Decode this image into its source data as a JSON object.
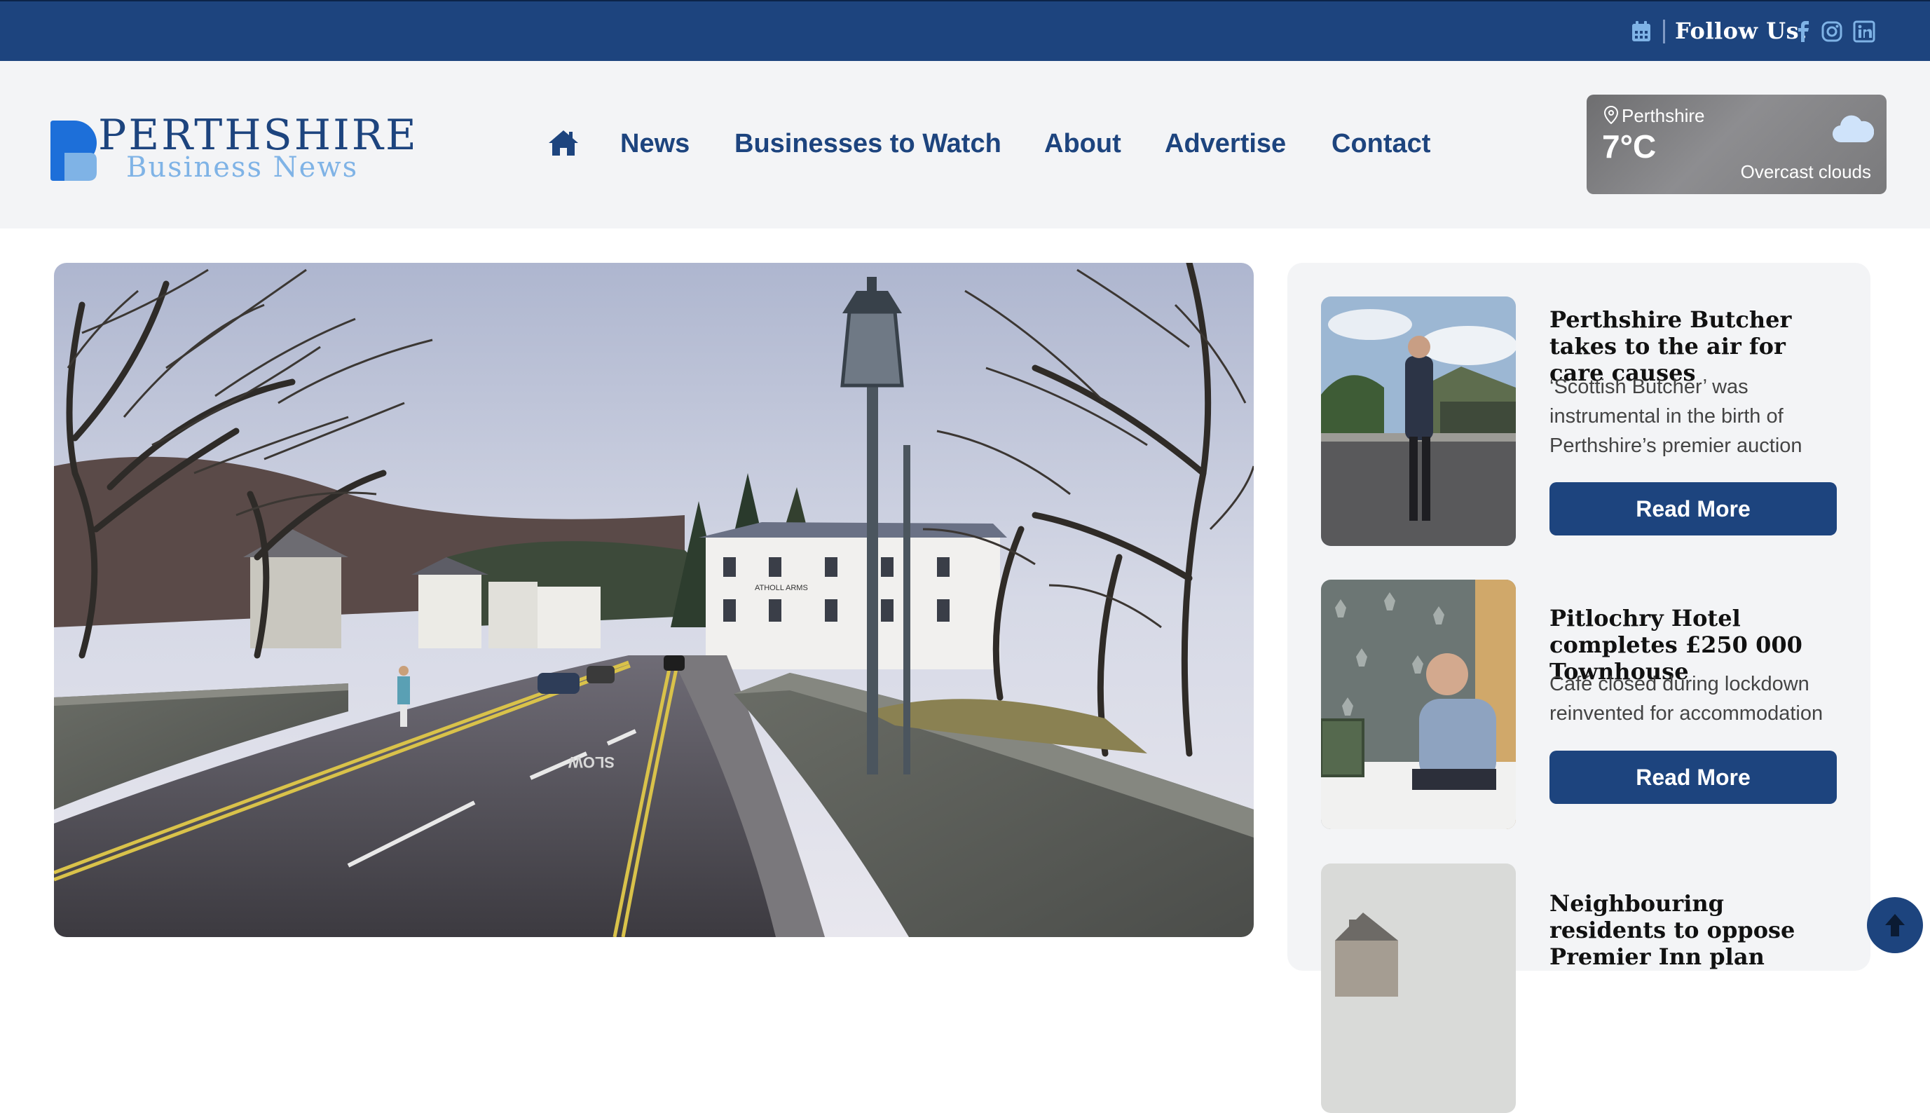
{
  "topbar": {
    "follow_label": "Follow Us:",
    "icons": [
      "calendar-icon",
      "facebook-icon",
      "instagram-icon",
      "linkedin-icon"
    ],
    "background": "#1d447e"
  },
  "header": {
    "logo": {
      "title": "PERTHSHIRE",
      "subtitle": "Business News"
    },
    "nav": [
      {
        "label": "News"
      },
      {
        "label": "Businesses to Watch"
      },
      {
        "label": "About"
      },
      {
        "label": "Advertise"
      },
      {
        "label": "Contact"
      }
    ],
    "weather": {
      "location": "Perthshire",
      "temperature": "7°C",
      "condition": "Overcast clouds"
    }
  },
  "hero": {
    "sign_text": "ATHOLL ARMS",
    "road_marking": "SLOW"
  },
  "sidebar": {
    "articles": [
      {
        "title": "Perthshire Butcher takes to the air for care causes",
        "excerpt": "‘Scottish Butcher’ was instrumental in the birth of Perthshire’s premier auction",
        "button": "Read More"
      },
      {
        "title": "Pitlochry Hotel completes £250 000 Townhouse",
        "excerpt": "Café closed during lockdown reinvented for accommodation",
        "button": "Read More"
      },
      {
        "title": "Neighbouring residents to oppose Premier Inn plan"
      }
    ]
  },
  "colors": {
    "brand": "#1d447e",
    "accent_light": "#7fb3e6",
    "panel": "#f3f4f6"
  }
}
